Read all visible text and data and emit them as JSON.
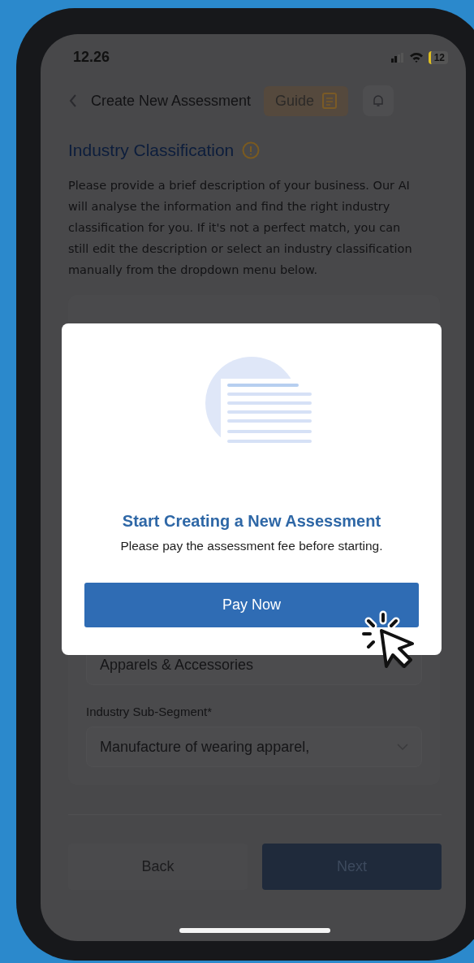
{
  "status_bar": {
    "time": "12.26",
    "battery": "12"
  },
  "header": {
    "title": "Create New Assessment",
    "guide_button": "Guide"
  },
  "section": {
    "title": "Industry Classification",
    "description": "Please provide a brief description of your business. Our AI will analyse the information and find the right industry classification for you. If it's not a perfect match, you can still edit the description or select an industry classification manually from the dropdown menu below."
  },
  "form": {
    "fields": [
      {
        "value": "Apparels & Accessories"
      },
      {
        "label": "Industry Sub-Segment*",
        "value": "Manufacture of wearing apparel,"
      }
    ]
  },
  "footer": {
    "back_button": "Back",
    "next_button": "Next"
  },
  "modal": {
    "title": "Start Creating a New Assessment",
    "message": "Please pay the assessment fee before starting.",
    "button": "Pay Now"
  }
}
